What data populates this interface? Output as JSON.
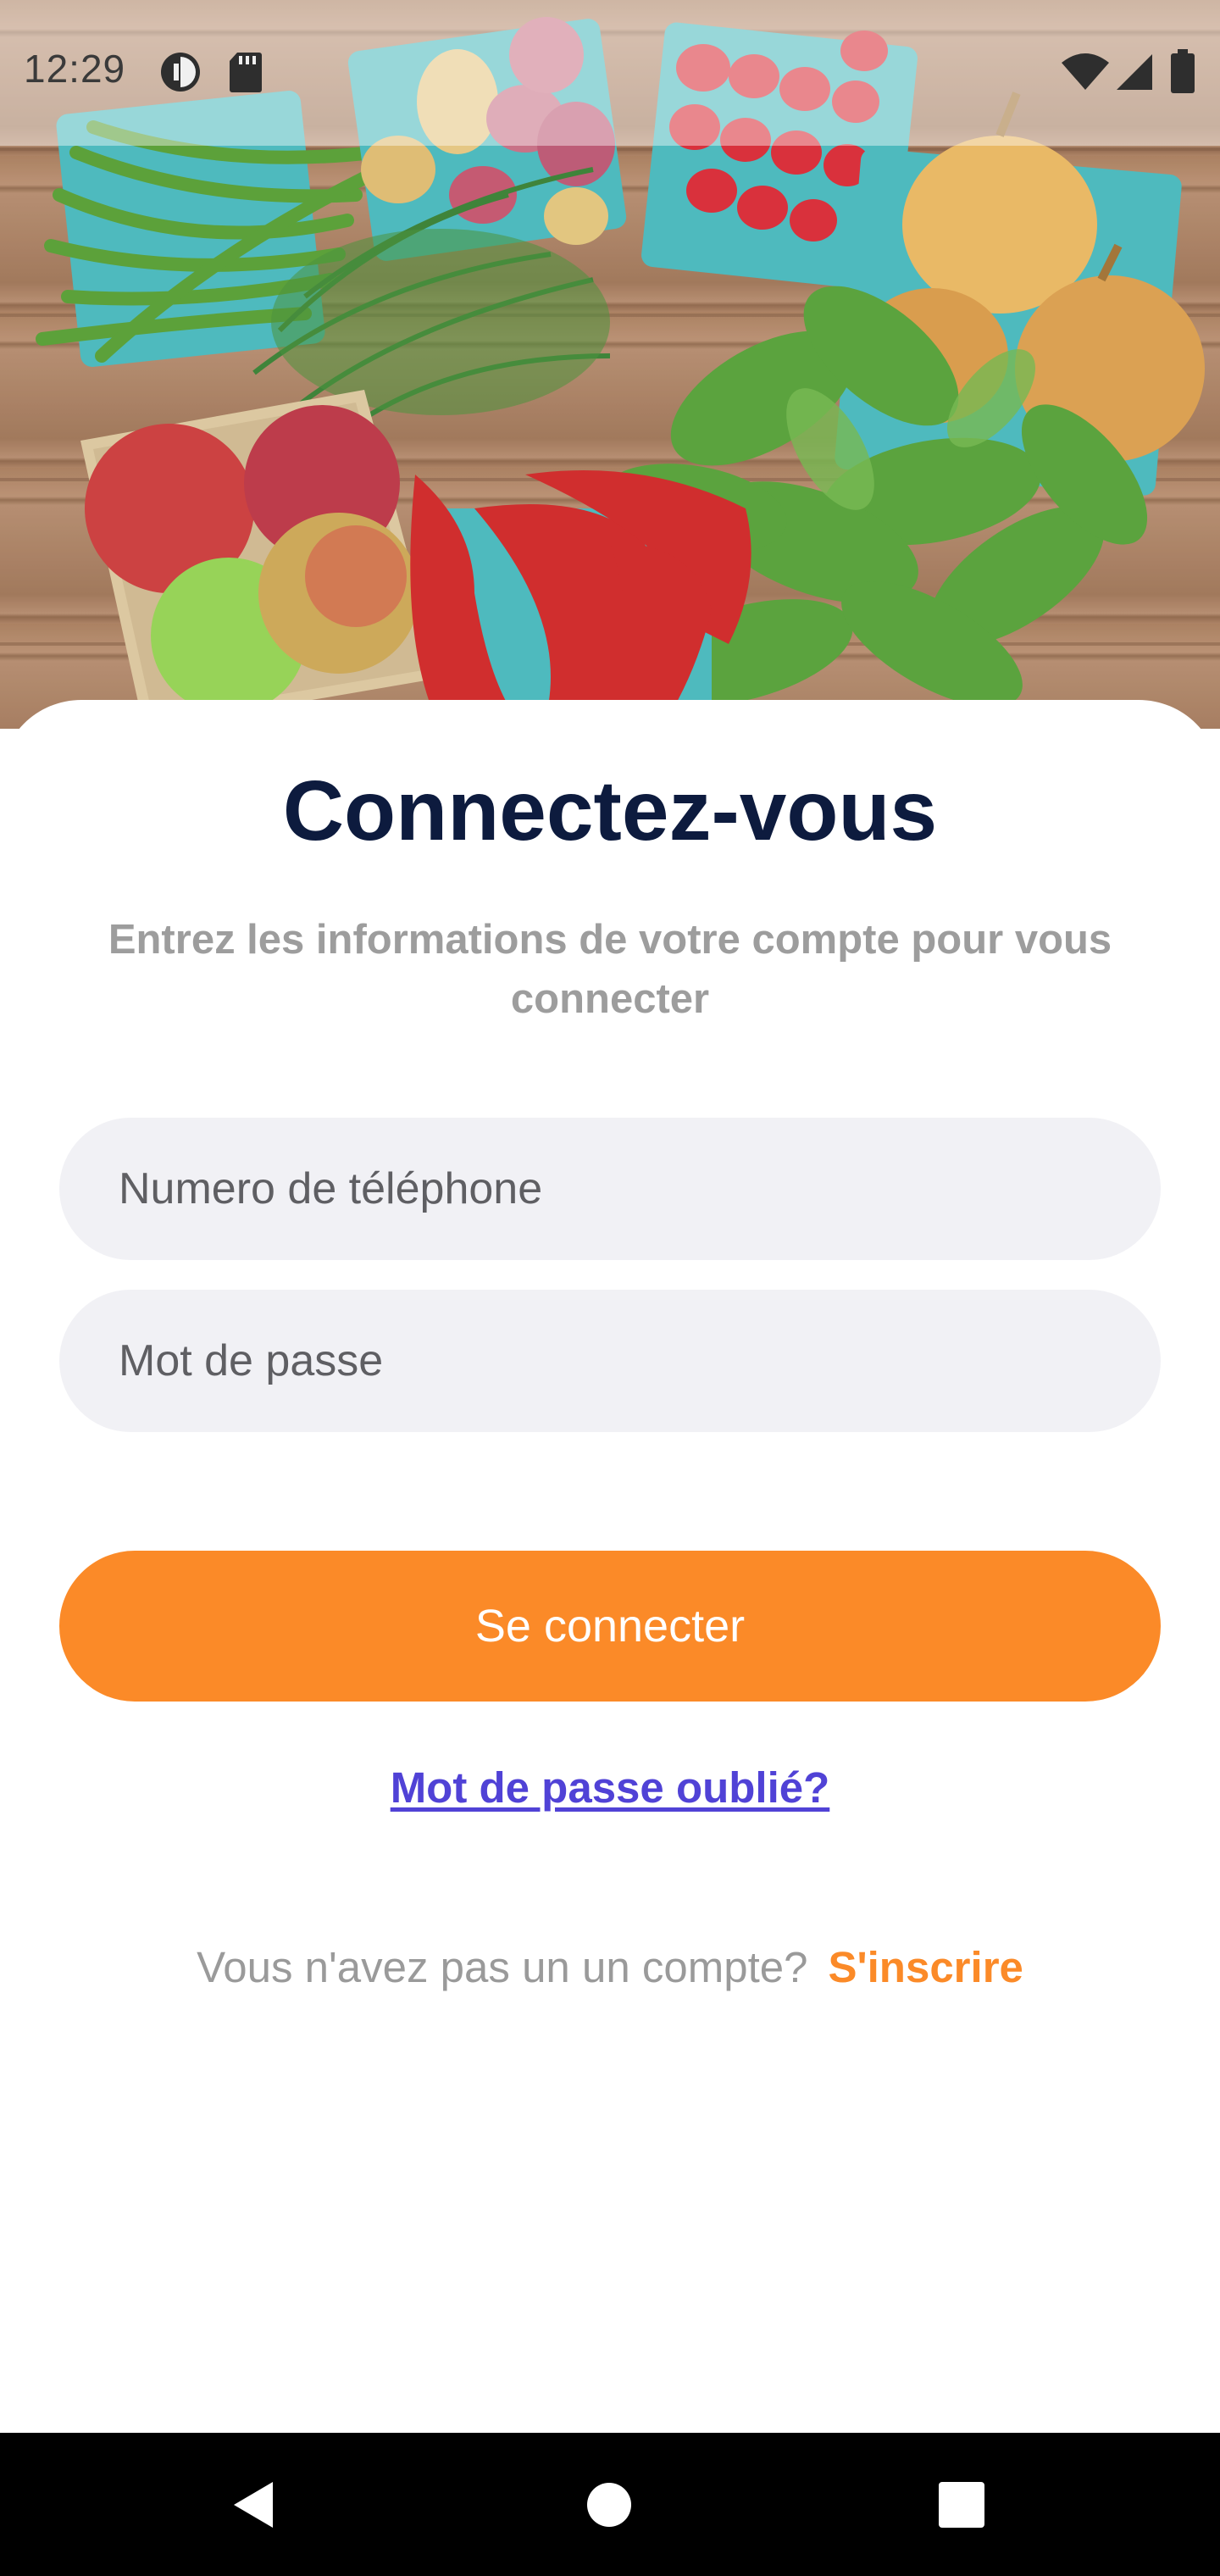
{
  "status_bar": {
    "time": "12:29",
    "icons": [
      "vpn-key-icon",
      "sd-card-icon",
      "wifi-icon",
      "cell-signal-icon",
      "battery-icon"
    ]
  },
  "hero": {
    "image": "fresh-vegetables-on-wood-table"
  },
  "login": {
    "title": "Connectez-vous",
    "subtitle": "Entrez les informations de votre compte pour vous connecter",
    "phone_placeholder": "Numero de téléphone",
    "password_placeholder": "Mot de passe",
    "submit_label": "Se connecter",
    "forgot_label": "Mot de passe oublié?",
    "signup_prompt": "Vous n'avez pas un un compte?",
    "signup_label": "S'inscrire"
  },
  "colors": {
    "accent": "#fb8a28",
    "title": "#0d1b3e",
    "link": "#5042d6",
    "field_bg": "#f1f1f5"
  },
  "nav_bar": {
    "buttons": [
      "back-icon",
      "home-icon",
      "recents-icon"
    ]
  }
}
